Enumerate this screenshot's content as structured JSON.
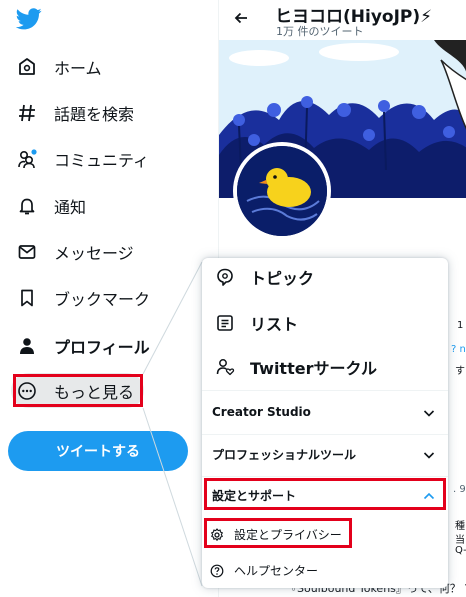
{
  "sidebar": {
    "logo_icon": "twitter-bird-icon",
    "items": [
      {
        "label": "ホーム",
        "icon": "home-icon"
      },
      {
        "label": "話題を検索",
        "icon": "hashtag-icon"
      },
      {
        "label": "コミュニティ",
        "icon": "communities-icon"
      },
      {
        "label": "通知",
        "icon": "bell-icon"
      },
      {
        "label": "メッセージ",
        "icon": "envelope-icon"
      },
      {
        "label": "ブックマーク",
        "icon": "bookmark-icon"
      },
      {
        "label": "プロフィール",
        "icon": "person-icon"
      },
      {
        "label": "もっと見る",
        "icon": "more-circle-icon"
      }
    ],
    "tweet_button": "ツイートする"
  },
  "profile": {
    "name": "ヒヨコロ(HiyoJP)⚡",
    "tweet_count": "1万 件のツイート"
  },
  "background_fragments": [
    "1 /",
    "? n",
    "す",
    ". 9",
    "種",
    "当",
    "Q-",
    "『Soulbound Tokens』って、何？ ?"
  ],
  "menu": {
    "items": [
      {
        "label": "トピック",
        "icon": "topic-icon"
      },
      {
        "label": "リスト",
        "icon": "list-icon"
      },
      {
        "label": "Twitterサークル",
        "icon": "twitter-circle-icon"
      }
    ],
    "sections": [
      {
        "label": "Creator Studio",
        "state": "collapsed"
      },
      {
        "label": "プロフェッショナルツール",
        "state": "collapsed"
      },
      {
        "label": "設定とサポート",
        "state": "expanded"
      }
    ],
    "subitems": [
      {
        "label": "設定とプライバシー",
        "icon": "gear-icon"
      },
      {
        "label": "ヘルプセンター",
        "icon": "help-circle-icon"
      }
    ]
  },
  "colors": {
    "accent": "#1d9bf0",
    "highlight_box": "#e3001b",
    "text": "#0f1419",
    "muted": "#536471"
  }
}
